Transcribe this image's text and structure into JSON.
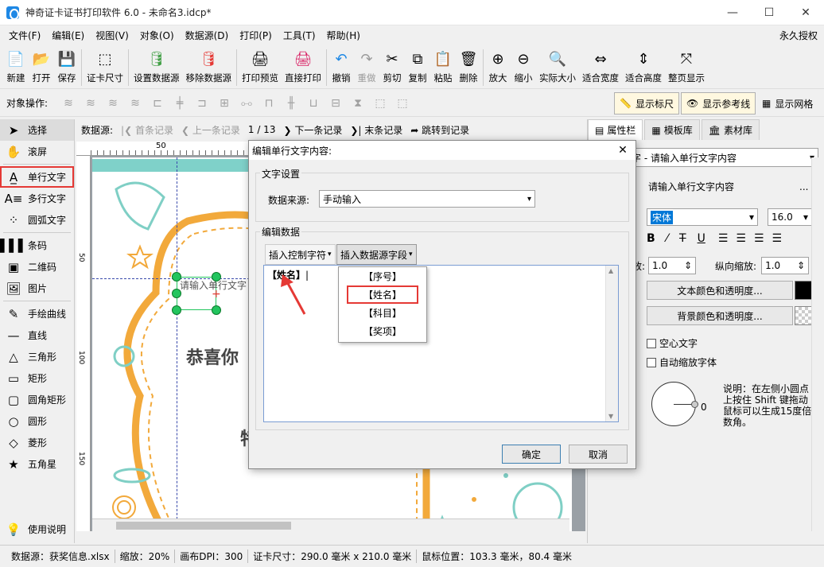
{
  "window": {
    "title": "神奇证卡证书打印软件 6.0 - 未命名3.idcp*"
  },
  "menu": {
    "items": [
      "文件(F)",
      "编辑(E)",
      "视图(V)",
      "对象(O)",
      "数据源(D)",
      "打印(P)",
      "工具(T)",
      "帮助(H)"
    ],
    "license": "永久授权"
  },
  "toolbar": {
    "new": "新建",
    "open": "打开",
    "save": "保存",
    "card_size": "证卡尺寸",
    "set_source": "设置数据源",
    "remove_source": "移除数据源",
    "print_preview": "打印预览",
    "direct_print": "直接打印",
    "undo": "撤销",
    "redo": "重做",
    "cut": "剪切",
    "copy": "复制",
    "paste": "粘贴",
    "delete": "删除",
    "zoom_in": "放大",
    "zoom_out": "缩小",
    "actual_size": "实际大小",
    "fit_width": "适合宽度",
    "fit_height": "适合高度",
    "full_page": "整页显示"
  },
  "ops": {
    "label": "对象操作:",
    "show_ruler": "显示标尺",
    "show_guides": "显示参考线",
    "show_grid": "显示网格"
  },
  "left_tools": {
    "select": "选择",
    "scroll": "滚屏",
    "single_text": "单行文字",
    "multi_text": "多行文字",
    "arc_text": "圆弧文字",
    "barcode": "条码",
    "qrcode": "二维码",
    "image": "图片",
    "freehand": "手绘曲线",
    "line": "直线",
    "triangle": "三角形",
    "rect": "矩形",
    "round_rect": "圆角矩形",
    "circle": "圆形",
    "diamond": "菱形",
    "star": "五角星",
    "help": "使用说明"
  },
  "records": {
    "label": "数据源:",
    "first": "首条记录",
    "prev": "上一条记录",
    "position": "1 / 13",
    "next": "下一条记录",
    "last": "末条记录",
    "jump": "跳转到记录"
  },
  "canvas": {
    "ruler_50": "50",
    "ruler_v_50": "50",
    "ruler_v_100": "100",
    "ruler_v_150": "150",
    "placeholder_text": "请输入单行文字",
    "heading": "恭喜你",
    "fragment": "特"
  },
  "right_panel": {
    "tabs": [
      "属性栏",
      "模板库",
      "素材库"
    ],
    "object_select": "字 - 请输入单行文字内容",
    "content": "请输入单行文字内容",
    "content_btn": "...",
    "font": "宋体",
    "font_size": "16.0",
    "h_scale": "1.0",
    "h_scale_label": "放:",
    "v_scale_label": "纵向缩放:",
    "v_scale": "1.0",
    "text_color_btn": "文本颜色和透明度...",
    "bg_color_btn": "背景颜色和透明度...",
    "hollow": "空心文字",
    "auto_shrink": "自动缩放字体",
    "angle": "0",
    "note": "说明：在左侧小圆点上按住 Shift 键拖动鼠标可以生成15度倍数角。"
  },
  "status": {
    "source": "数据源：获奖信息.xlsx",
    "zoom": "缩放：20%",
    "dpi": "画布DPI：300",
    "card_size": "证卡尺寸：290.0 毫米 x 210.0 毫米",
    "mouse": "鼠标位置：103.3 毫米，80.4 毫米"
  },
  "dialog": {
    "title": "编辑单行文字内容:",
    "text_settings": "文字设置",
    "source_label": "数据来源:",
    "source_value": "手动输入",
    "edit_data": "编辑数据",
    "insert_ctrl": "插入控制字符",
    "insert_field": "插入数据源字段",
    "text_value": "【姓名】",
    "dropdown": [
      "【序号】",
      "【姓名】",
      "【科目】",
      "【奖项】"
    ],
    "ok": "确定",
    "cancel": "取消"
  }
}
